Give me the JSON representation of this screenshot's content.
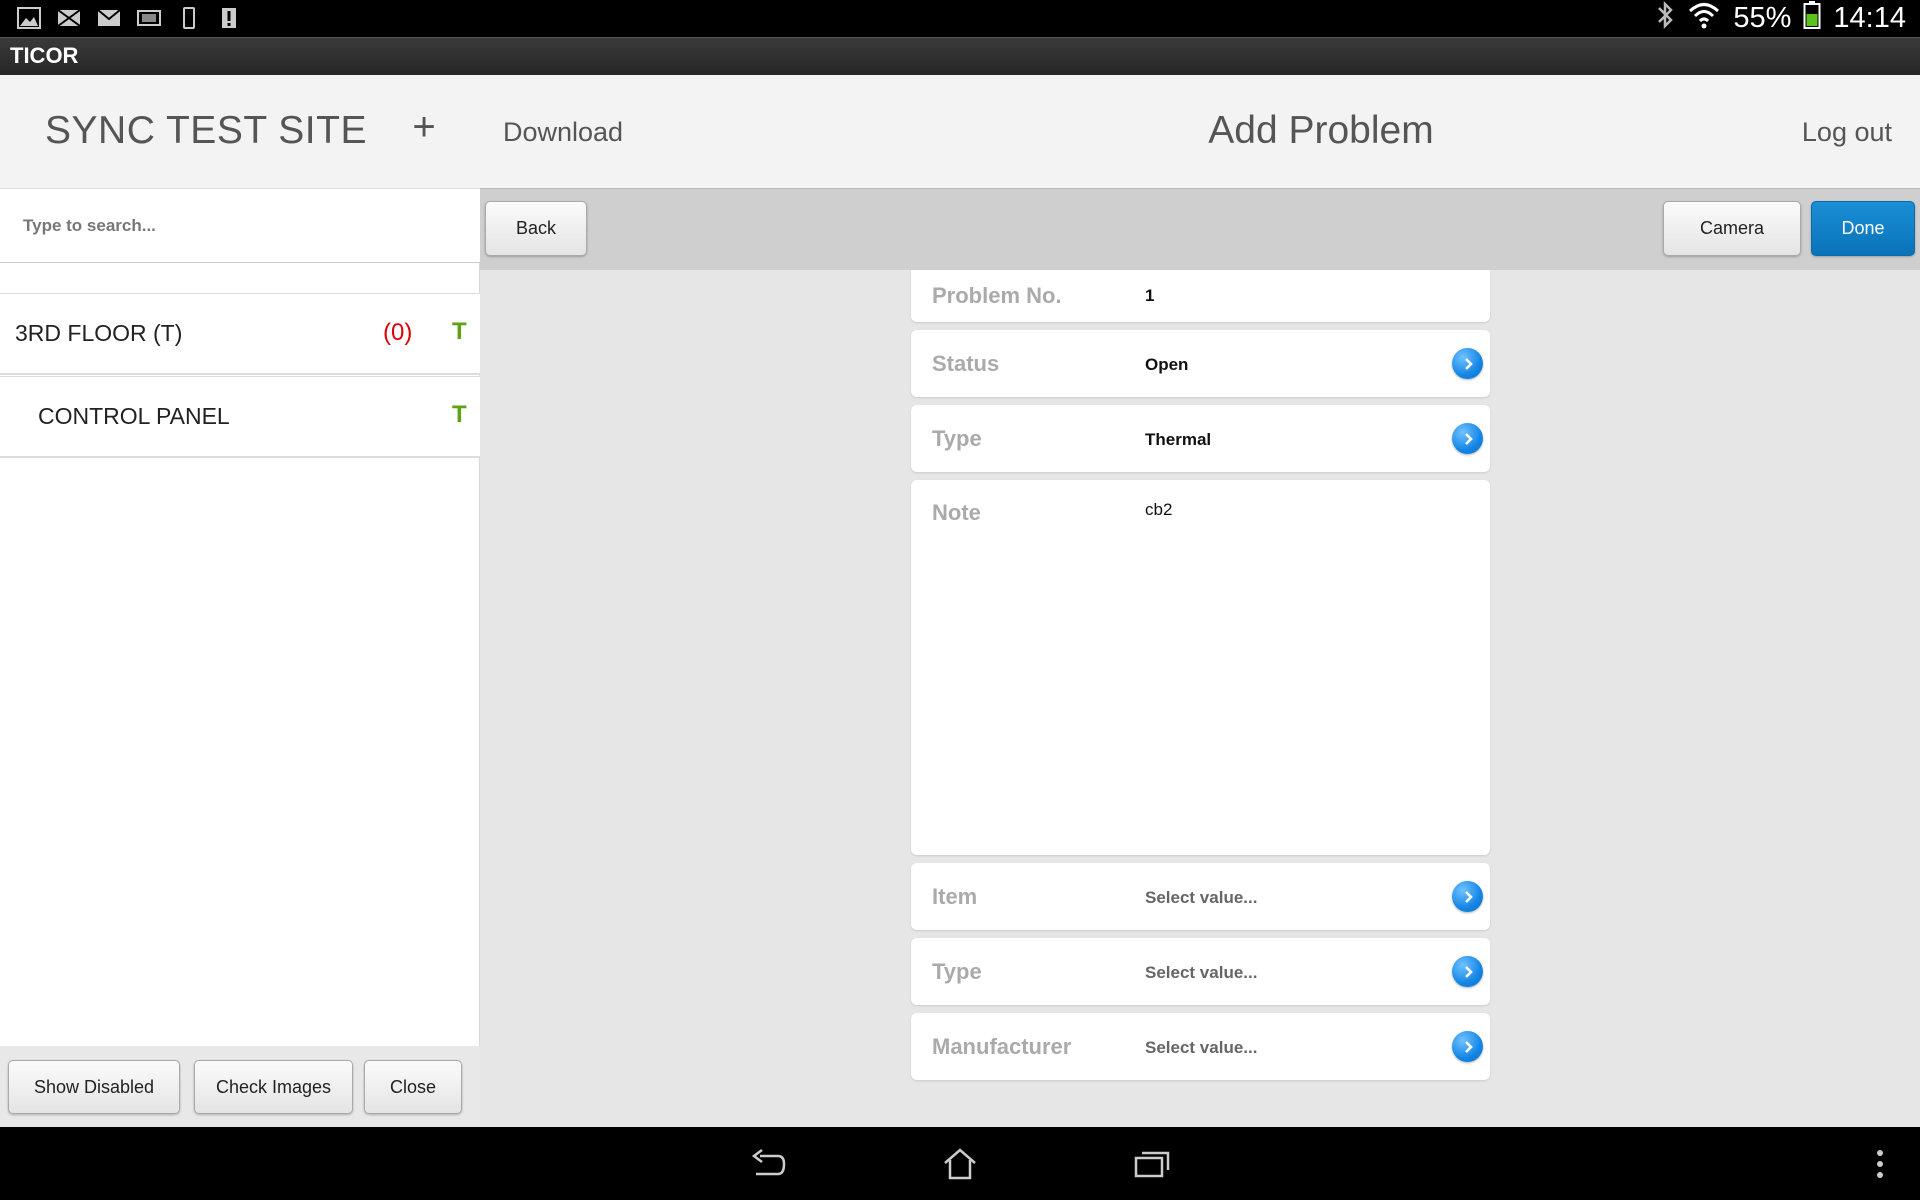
{
  "status_bar": {
    "battery": "55%",
    "time": "14:14",
    "notification_icons": [
      "gallery-icon",
      "mail-icon",
      "email-icon",
      "screen-icon",
      "phone-icon",
      "sd-warning-icon"
    ]
  },
  "app": {
    "title": "TICOR"
  },
  "sidebar": {
    "site_title": "SYNC TEST SITE",
    "add_label": "+",
    "search_placeholder": "Type to search...",
    "items": [
      {
        "label": "3RD FLOOR (T)",
        "count": "(0)",
        "flag": "T"
      },
      {
        "label": "CONTROL PANEL",
        "flag": "T"
      }
    ],
    "footer": {
      "show_disabled": "Show Disabled",
      "check_images": "Check Images",
      "close": "Close"
    }
  },
  "header": {
    "download": "Download",
    "title": "Add Problem",
    "logout": "Log out"
  },
  "toolbar": {
    "back": "Back",
    "camera": "Camera",
    "done": "Done"
  },
  "form": {
    "problem_no": {
      "label": "Problem No.",
      "value": "1"
    },
    "status": {
      "label": "Status",
      "value": "Open"
    },
    "type": {
      "label": "Type",
      "value": "Thermal"
    },
    "note": {
      "label": "Note",
      "value": "cb2"
    },
    "item": {
      "label": "Item",
      "placeholder": "Select value..."
    },
    "item_type": {
      "label": "Type",
      "placeholder": "Select value..."
    },
    "manufacturer": {
      "label": "Manufacturer",
      "placeholder": "Select value..."
    }
  },
  "colors": {
    "accent_blue": "#0a7fc9",
    "count_red": "#e00000",
    "flag_green": "#5fa214"
  }
}
